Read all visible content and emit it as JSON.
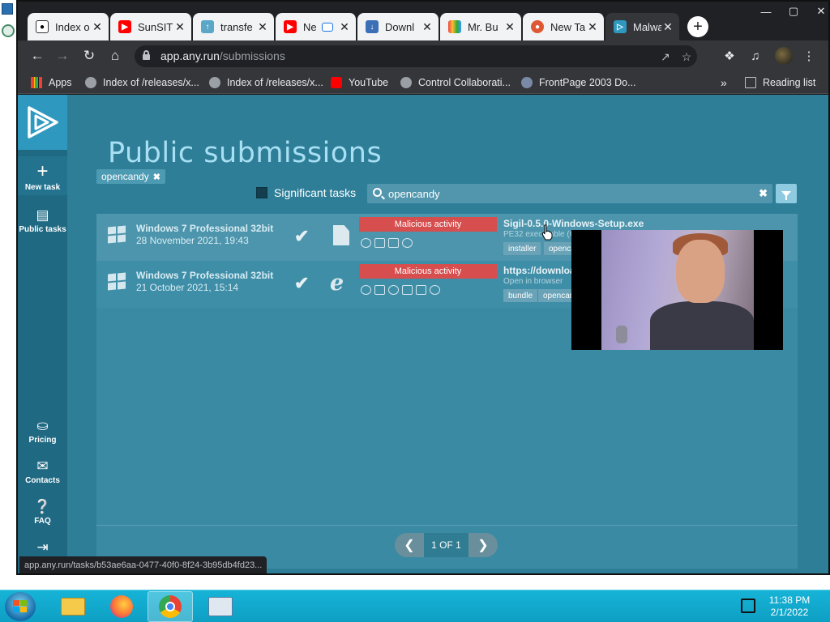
{
  "browser": {
    "tabs": [
      {
        "title": "Index o",
        "favicon": "github-icon",
        "active": false
      },
      {
        "title": "SunSIT",
        "favicon": "youtube-icon",
        "active": false
      },
      {
        "title": "transfe",
        "favicon": "upload-icon",
        "active": false
      },
      {
        "title": "Ne",
        "favicon": "youtube-icon",
        "active": false
      },
      {
        "title": "Downl",
        "favicon": "download-site-icon",
        "active": false
      },
      {
        "title": "Mr. Bu",
        "favicon": "rainbow-icon",
        "active": false
      },
      {
        "title": "New Ta",
        "favicon": "duckduckgo-icon",
        "active": false
      },
      {
        "title": "Malwa",
        "favicon": "anyrun-icon",
        "active": true
      }
    ],
    "url_host": "app.any.run",
    "url_path": "/submissions",
    "bookmarks": [
      {
        "label": "Apps",
        "icon": "apps-grid-icon"
      },
      {
        "label": "Index of /releases/x...",
        "icon": "globe-icon"
      },
      {
        "label": "Index of /releases/x...",
        "icon": "globe-icon"
      },
      {
        "label": "YouTube",
        "icon": "youtube-icon"
      },
      {
        "label": "Control Collaborati...",
        "icon": "globe-icon"
      },
      {
        "label": "FrontPage 2003 Do...",
        "icon": "globe-icon"
      }
    ],
    "reading_list": "Reading list",
    "overflow": "»"
  },
  "sidebar": {
    "new_task": "New task",
    "public_tasks": "Public tasks",
    "pricing": "Pricing",
    "contacts": "Contacts",
    "faq": "FAQ"
  },
  "page": {
    "title": "Public submissions",
    "active_tag": "opencandy",
    "significant_label": "Significant tasks",
    "search_value": "opencandy"
  },
  "rows": [
    {
      "os": "Windows 7 Professional 32bit",
      "date": "28 November 2021, 19:43",
      "verdict": "Malicious activity",
      "name": "Sigil-0.5.0-Windows-Setup.exe",
      "sub": "PE32 executable (GUI) Intel 80386, for MS Windows",
      "tags": [
        "installer",
        "opencandy"
      ],
      "type_icon": "file-icon"
    },
    {
      "os": "Windows 7 Professional 32bit",
      "date": "21 October 2021, 15:14",
      "verdict": "Malicious activity",
      "name": "https://download",
      "sub": "Open in browser",
      "tags": [
        "bundle",
        "opencandy"
      ],
      "type_icon": "internet-explorer-icon"
    }
  ],
  "pagination": {
    "label": "1 OF 1"
  },
  "status_url": "app.any.run/tasks/b53ae6aa-0477-40f0-8f24-3b95db4fd23...",
  "taskbar": {
    "time": "11:38 PM",
    "date": "2/1/2022"
  },
  "colors": {
    "page_bg": "#2e7e98",
    "sidebar_bg": "#1f6983",
    "title": "#a8dff2",
    "malicious": "#d74e4f",
    "chrome_dark": "#35363a"
  }
}
